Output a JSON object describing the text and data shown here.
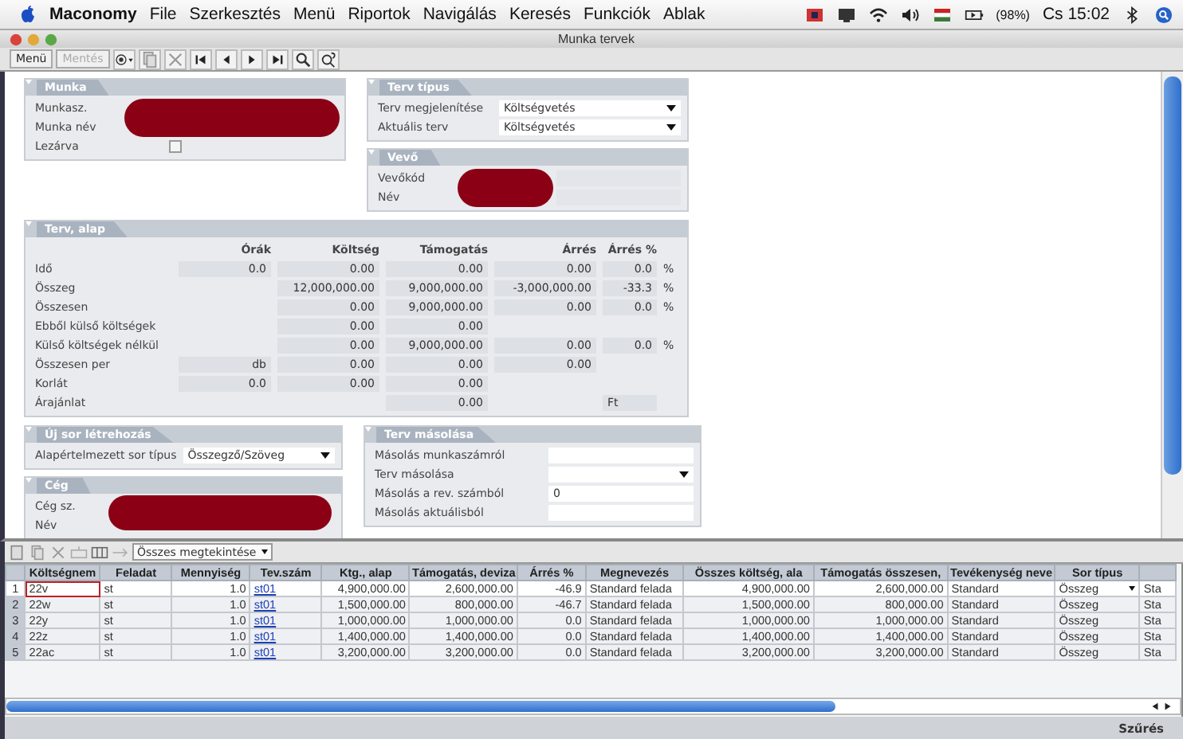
{
  "menubar": {
    "app": "Maconomy",
    "items": [
      "File",
      "Szerkesztés",
      "Menü",
      "Riportok",
      "Navigálás",
      "Keresés",
      "Funkciók",
      "Ablak"
    ],
    "battery": "(98%)",
    "clock": "Cs 15:02"
  },
  "window": {
    "title": "Munka tervek"
  },
  "toolbar": {
    "buttons": [
      {
        "label": "Menü",
        "disabled": false
      },
      {
        "label": "Mentés",
        "disabled": true
      }
    ]
  },
  "munka": {
    "title": "Munka",
    "fields": [
      {
        "label": "Munkasz."
      },
      {
        "label": "Munka név"
      },
      {
        "label": "Lezárva",
        "kind": "checkbox",
        "checked": false
      }
    ]
  },
  "terv_tipus": {
    "title": "Terv típus",
    "fields": [
      {
        "label": "Terv megjelenítése",
        "value": "Költségvetés",
        "kind": "dropdown"
      },
      {
        "label": "Aktuális terv",
        "value": "Költségvetés",
        "kind": "dropdown"
      }
    ]
  },
  "vevo": {
    "title": "Vevő",
    "fields": [
      {
        "label": "Vevőkód",
        "kind": "text"
      },
      {
        "label": "Név",
        "kind": "text"
      }
    ]
  },
  "terv_alap": {
    "title": "Terv, alap",
    "columns": [
      "Órák",
      "Költség",
      "Támogatás",
      "Árrés",
      "Árrés %"
    ],
    "rows": [
      {
        "label": "Idő",
        "cells": [
          "0.0",
          "0.00",
          "0.00",
          "0.00",
          "0.0"
        ],
        "unit": "%"
      },
      {
        "label": "Összeg",
        "cells": [
          null,
          "12,000,000.00",
          "9,000,000.00",
          "-3,000,000.00",
          "-33.3"
        ],
        "unit": "%"
      },
      {
        "label": "Összesen",
        "cells": [
          null,
          "0.00",
          "9,000,000.00",
          "0.00",
          "0.0"
        ],
        "unit": "%"
      },
      {
        "label": "Ebből külső költségek",
        "cells": [
          null,
          "0.00",
          "0.00",
          null,
          null
        ]
      },
      {
        "label": "Külső költségek nélkül",
        "cells": [
          null,
          "0.00",
          "9,000,000.00",
          "0.00",
          "0.0"
        ],
        "unit": "%"
      },
      {
        "label": "Összesen per",
        "cells": [
          "db",
          "0.00",
          "0.00",
          "0.00",
          null
        ]
      },
      {
        "label": "Korlát",
        "cells": [
          "0.0",
          "0.00",
          "0.00",
          null,
          null
        ]
      },
      {
        "label": "Árajánlat",
        "cells": [
          null,
          null,
          "0.00",
          null,
          "Ft"
        ]
      }
    ]
  },
  "uj_sor": {
    "title": "Új sor létrehozás",
    "fields": [
      {
        "label": "Alapértelmezett sor típus",
        "value": "Összegző/Szöveg",
        "kind": "dropdown"
      }
    ]
  },
  "ceg": {
    "title": "Cég",
    "fields": [
      {
        "label": "Cég sz."
      },
      {
        "label": "Név"
      }
    ]
  },
  "terv_masolasa": {
    "title": "Terv másolása",
    "fields": [
      {
        "label": "Másolás munkaszámról",
        "kind": "text"
      },
      {
        "label": "Terv másolása",
        "kind": "dropdown"
      },
      {
        "label": "Másolás a rev. számból",
        "value": "0",
        "kind": "text"
      },
      {
        "label": "Másolás aktuálisból",
        "kind": "text"
      }
    ]
  },
  "grid_toolbar": {
    "view": "Összes megtekintése"
  },
  "table": {
    "columns": [
      "Költségnem",
      "Feladat",
      "Mennyiség",
      "Tev.szám",
      "Ktg., alap",
      "Támogatás, deviza",
      "Árrés %",
      "Megnevezés",
      "Összes költség, ala",
      "Támogatás összesen,",
      "Tevékenység neve",
      "Sor típus"
    ],
    "rows": [
      {
        "num": "1",
        "selected": true,
        "cells": [
          "22v",
          "st",
          "1.0",
          "st01",
          "4,900,000.00",
          "2,600,000.00",
          "-46.9",
          "Standard felada",
          "4,900,000.00",
          "2,600,000.00",
          "Standard",
          "Összeg",
          "Sta"
        ]
      },
      {
        "num": "2",
        "selected": false,
        "cells": [
          "22w",
          "st",
          "1.0",
          "st01",
          "1,500,000.00",
          "800,000.00",
          "-46.7",
          "Standard felada",
          "1,500,000.00",
          "800,000.00",
          "Standard",
          "Összeg",
          "Sta"
        ]
      },
      {
        "num": "3",
        "selected": false,
        "cells": [
          "22y",
          "st",
          "1.0",
          "st01",
          "1,000,000.00",
          "1,000,000.00",
          "0.0",
          "Standard felada",
          "1,000,000.00",
          "1,000,000.00",
          "Standard",
          "Összeg",
          "Sta"
        ]
      },
      {
        "num": "4",
        "selected": false,
        "cells": [
          "22z",
          "st",
          "1.0",
          "st01",
          "1,400,000.00",
          "1,400,000.00",
          "0.0",
          "Standard felada",
          "1,400,000.00",
          "1,400,000.00",
          "Standard",
          "Összeg",
          "Sta"
        ]
      },
      {
        "num": "5",
        "selected": false,
        "cells": [
          "22ac",
          "st",
          "1.0",
          "st01",
          "3,200,000.00",
          "3,200,000.00",
          "0.0",
          "Standard felada",
          "3,200,000.00",
          "3,200,000.00",
          "Standard",
          "Összeg",
          "Sta"
        ]
      }
    ]
  },
  "status_bar": {
    "label": "Szűrés"
  }
}
